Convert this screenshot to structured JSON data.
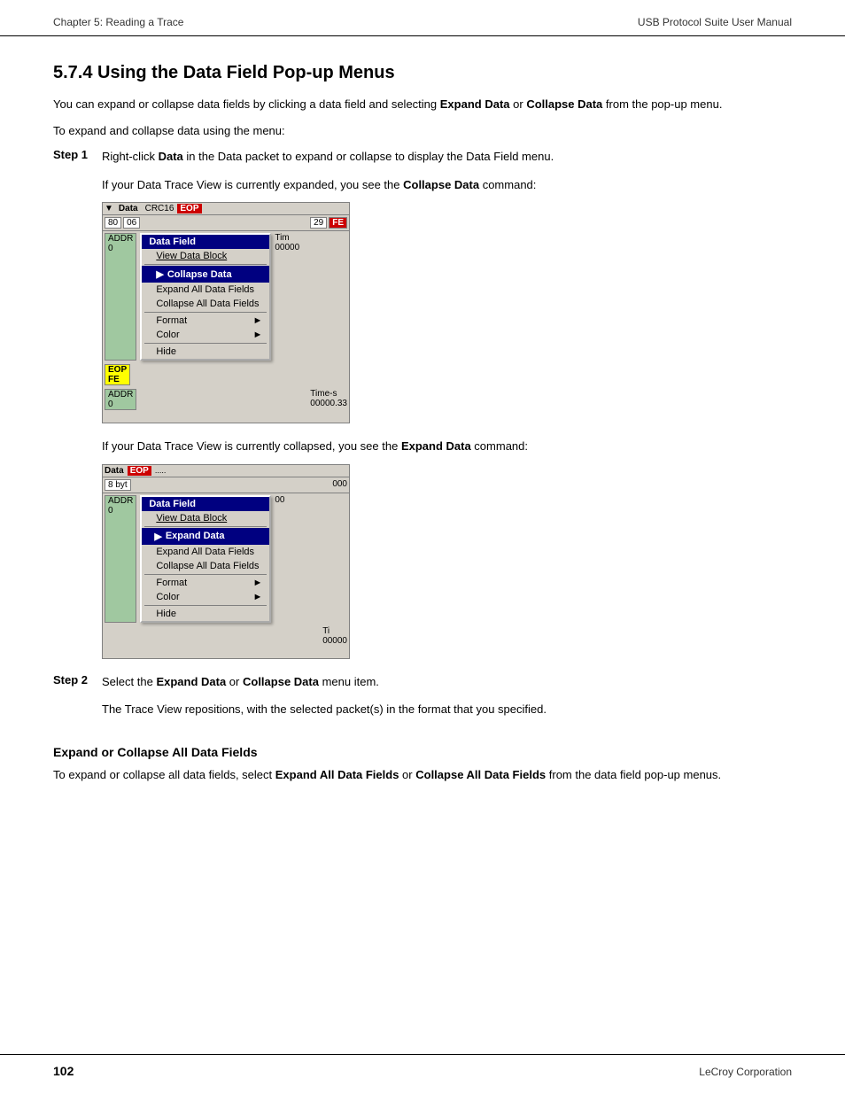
{
  "header": {
    "left": "Chapter 5: Reading a Trace",
    "right": "USB Protocol Suite User Manual"
  },
  "footer": {
    "page_number": "102",
    "company": "LeCroy Corporation"
  },
  "section": {
    "title": "5.7.4 Using the Data Field Pop-up Menus",
    "intro1": "You can expand or collapse data fields by clicking a data field and selecting ",
    "intro1_bold1": "Expand Data",
    "intro1_mid": " or ",
    "intro1_bold2": "Collapse Data",
    "intro1_end": " from the pop-up menu.",
    "intro2": "To expand and collapse data using the menu:",
    "step1_label": "Step 1",
    "step1_text1": "Right-click ",
    "step1_bold": "Data",
    "step1_text2": " in the Data packet to expand or collapse to display the Data Field menu.",
    "if_collapsed_text1": "If your Data Trace View is currently expanded, you see the ",
    "if_collapsed_bold": "Collapse Data",
    "if_collapsed_text2": " command:",
    "if_expanded_text1": "If your Data Trace View is currently collapsed, you see the ",
    "if_expanded_bold": "Expand Data",
    "if_expanded_text2": " command:",
    "step2_label": "Step 2",
    "step2_text1": "Select the ",
    "step2_bold1": "Expand Data",
    "step2_text2": " or ",
    "step2_bold2": "Collapse Data",
    "step2_text3": " menu item.",
    "step2_note": "The Trace View repositions, with the selected packet(s) in the format that you specified.",
    "subheading": "Expand or Collapse All Data Fields",
    "sub_intro1": "To expand or collapse all data fields, select ",
    "sub_bold1": "Expand All Data Fields",
    "sub_mid": " or ",
    "sub_bold2": "Collapse All Data Fields",
    "sub_end": " from the data field pop-up menus."
  },
  "menu1": {
    "title": "Data Field",
    "items": [
      {
        "label": "View Data Block",
        "bold": false,
        "highlighted": false,
        "underline": true,
        "arrow": false
      },
      {
        "label": "Collapse Data",
        "bold": true,
        "highlighted": true,
        "underline": false,
        "arrow": false
      },
      {
        "label": "Expand All Data Fields",
        "bold": false,
        "highlighted": false,
        "underline": false,
        "arrow": false
      },
      {
        "label": "Collapse All Data Fields",
        "bold": false,
        "highlighted": false,
        "underline": false,
        "arrow": false
      },
      {
        "divider": true
      },
      {
        "label": "Format",
        "bold": false,
        "highlighted": false,
        "underline": false,
        "arrow": true
      },
      {
        "label": "Color",
        "bold": false,
        "highlighted": false,
        "underline": false,
        "arrow": true
      },
      {
        "label": "Hide",
        "bold": false,
        "highlighted": false,
        "underline": false,
        "arrow": false
      }
    ]
  },
  "menu2": {
    "title": "Data Field",
    "items": [
      {
        "label": "View Data Block",
        "bold": false,
        "highlighted": false,
        "underline": true,
        "arrow": false
      },
      {
        "label": "Expand Data",
        "bold": true,
        "highlighted": true,
        "underline": false,
        "arrow": false
      },
      {
        "label": "Expand All Data Fields",
        "bold": false,
        "highlighted": false,
        "underline": false,
        "arrow": false
      },
      {
        "label": "Collapse All Data Fields",
        "bold": false,
        "highlighted": false,
        "underline": false,
        "arrow": false
      },
      {
        "divider": true
      },
      {
        "label": "Format",
        "bold": false,
        "highlighted": false,
        "underline": false,
        "arrow": true
      },
      {
        "label": "Color",
        "bold": false,
        "highlighted": false,
        "underline": false,
        "arrow": true
      },
      {
        "label": "Hide",
        "bold": false,
        "highlighted": false,
        "underline": false,
        "arrow": false
      }
    ]
  }
}
